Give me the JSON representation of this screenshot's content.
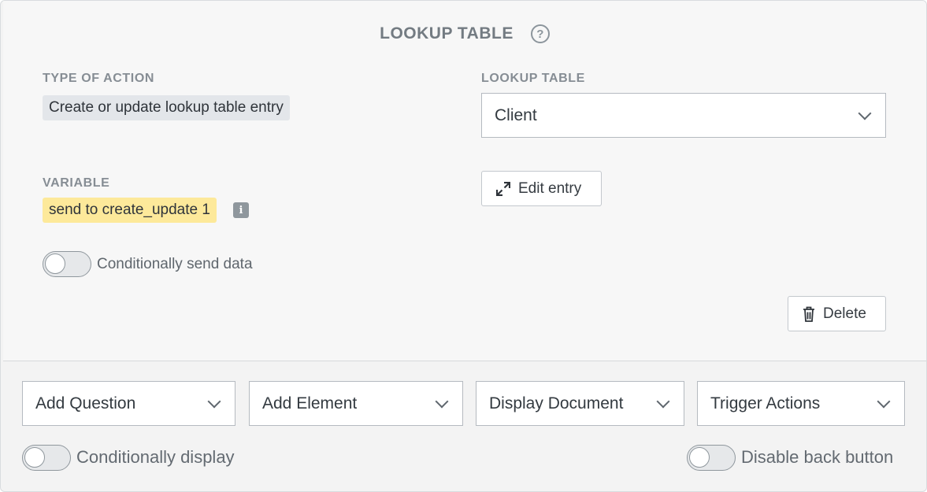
{
  "card": {
    "title": "LOOKUP TABLE",
    "help_icon": "question-circle-icon",
    "type_of_action": {
      "label": "TYPE OF ACTION",
      "value": "Create or update lookup table entry"
    },
    "lookup_table": {
      "label": "LOOKUP TABLE",
      "selected": "Client"
    },
    "variable": {
      "label": "VARIABLE",
      "value": "send to create_update 1",
      "info_icon": "info-icon"
    },
    "edit_entry_label": "Edit entry",
    "conditional_send_label": "Conditionally send data",
    "delete_label": "Delete"
  },
  "footer": {
    "dropdowns": [
      {
        "label": "Add Question"
      },
      {
        "label": "Add Element"
      },
      {
        "label": "Display Document"
      },
      {
        "label": "Trigger Actions"
      }
    ],
    "conditionally_display_label": "Conditionally display",
    "disable_back_label": "Disable back button"
  },
  "colors": {
    "variable_highlight": "#fde99a",
    "action_pill": "#e3e6ea"
  }
}
